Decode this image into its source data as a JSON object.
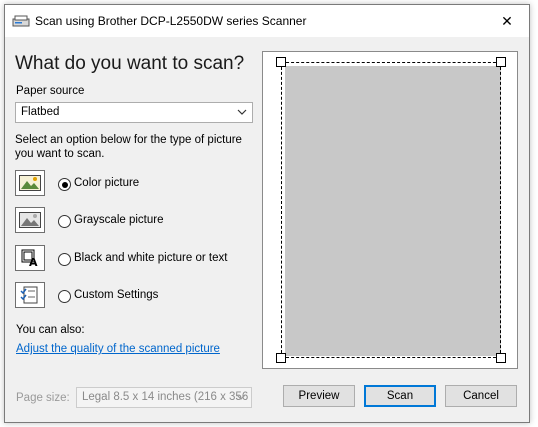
{
  "window": {
    "title": "Scan using Brother DCP-L2550DW series Scanner",
    "close_glyph": "✕"
  },
  "main": {
    "heading": "What do you want to scan?",
    "paper_source_label": "Paper source",
    "paper_source_value": "Flatbed",
    "instructions": "Select an option below for the type of picture you want to scan.",
    "options": [
      {
        "label": "Color picture",
        "icon": "color-picture-icon",
        "selected": true
      },
      {
        "label": "Grayscale picture",
        "icon": "grayscale-picture-icon",
        "selected": false
      },
      {
        "label": "Black and white picture or text",
        "icon": "black-white-picture-icon",
        "selected": false
      },
      {
        "label": "Custom Settings",
        "icon": "custom-settings-icon",
        "selected": false
      }
    ],
    "you_can_also": "You can also:",
    "adjust_link": "Adjust the quality of the scanned picture",
    "page_size_label": "Page size:",
    "page_size_value": "Legal 8.5 x 14 inches (216 x 356"
  },
  "buttons": {
    "preview": "Preview",
    "scan": "Scan",
    "cancel": "Cancel"
  },
  "colors": {
    "link": "#0066cc",
    "default_button_border": "#0078d7",
    "preview_area": "#c8c8c8"
  }
}
